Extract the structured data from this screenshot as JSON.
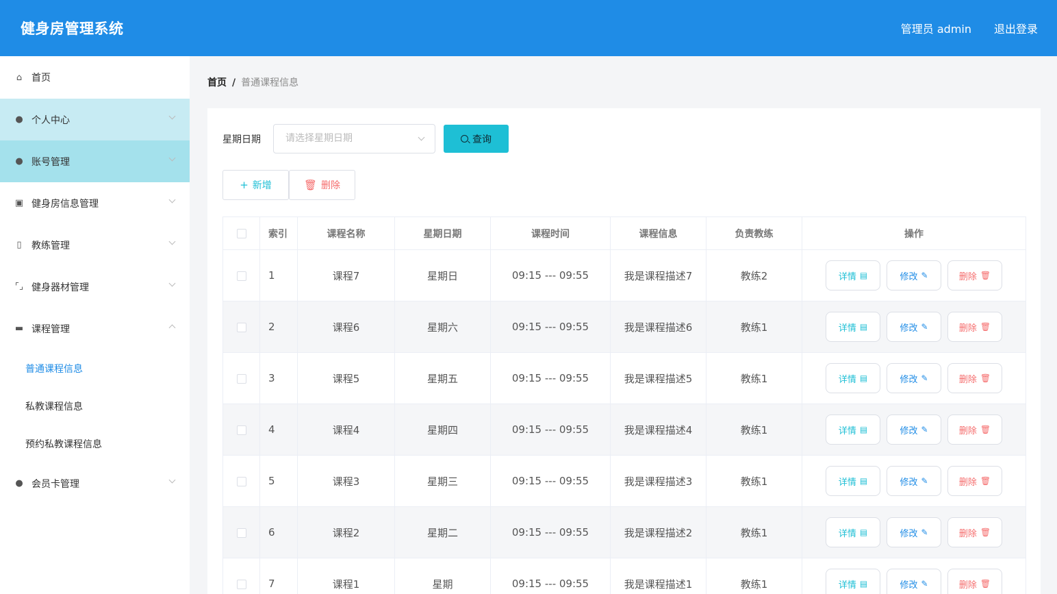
{
  "app": {
    "title": "健身房管理系统",
    "user_label": "管理员 admin",
    "logout_label": "退出登录"
  },
  "sidebar": {
    "items": [
      {
        "label": "首页",
        "icon": "home-icon",
        "glyph": "⌂"
      },
      {
        "label": "个人中心",
        "icon": "user-icon",
        "glyph": "●"
      },
      {
        "label": "账号管理",
        "icon": "user-icon",
        "glyph": "●"
      },
      {
        "label": "健身房信息管理",
        "icon": "chart-icon",
        "glyph": "▣"
      },
      {
        "label": "教练管理",
        "icon": "badge-icon",
        "glyph": "▯"
      },
      {
        "label": "健身器材管理",
        "icon": "frame-icon",
        "glyph": "⌜⌟"
      },
      {
        "label": "课程管理",
        "icon": "board-icon",
        "glyph": "▬"
      },
      {
        "label": "会员卡管理",
        "icon": "bulb-icon",
        "glyph": "●"
      }
    ],
    "sub_items": [
      "普通课程信息",
      "私教课程信息",
      "预约私教课程信息"
    ]
  },
  "breadcrumb": {
    "home": "首页",
    "sep": "/",
    "current": "普通课程信息"
  },
  "filter": {
    "label": "星期日期",
    "placeholder": "请选择星期日期",
    "query_label": "查询"
  },
  "actions": {
    "add_label": "新增",
    "delete_label": "删除"
  },
  "table": {
    "headers": [
      "索引",
      "课程名称",
      "星期日期",
      "课程时间",
      "课程信息",
      "负责教练",
      "操作"
    ],
    "op_labels": {
      "detail": "详情",
      "edit": "修改",
      "remove": "删除"
    },
    "rows": [
      {
        "index": "1",
        "name": "课程7",
        "day": "星期日",
        "time": "09:15 --- 09:55",
        "info": "我是课程描述7",
        "coach": "教练2"
      },
      {
        "index": "2",
        "name": "课程6",
        "day": "星期六",
        "time": "09:15 --- 09:55",
        "info": "我是课程描述6",
        "coach": "教练1"
      },
      {
        "index": "3",
        "name": "课程5",
        "day": "星期五",
        "time": "09:15 --- 09:55",
        "info": "我是课程描述5",
        "coach": "教练1"
      },
      {
        "index": "4",
        "name": "课程4",
        "day": "星期四",
        "time": "09:15 --- 09:55",
        "info": "我是课程描述4",
        "coach": "教练1"
      },
      {
        "index": "5",
        "name": "课程3",
        "day": "星期三",
        "time": "09:15 --- 09:55",
        "info": "我是课程描述3",
        "coach": "教练1"
      },
      {
        "index": "6",
        "name": "课程2",
        "day": "星期二",
        "time": "09:15 --- 09:55",
        "info": "我是课程描述2",
        "coach": "教练1"
      },
      {
        "index": "7",
        "name": "课程1",
        "day": "星期",
        "time": "09:15 --- 09:55",
        "info": "我是课程描述1",
        "coach": "教练1"
      }
    ]
  }
}
